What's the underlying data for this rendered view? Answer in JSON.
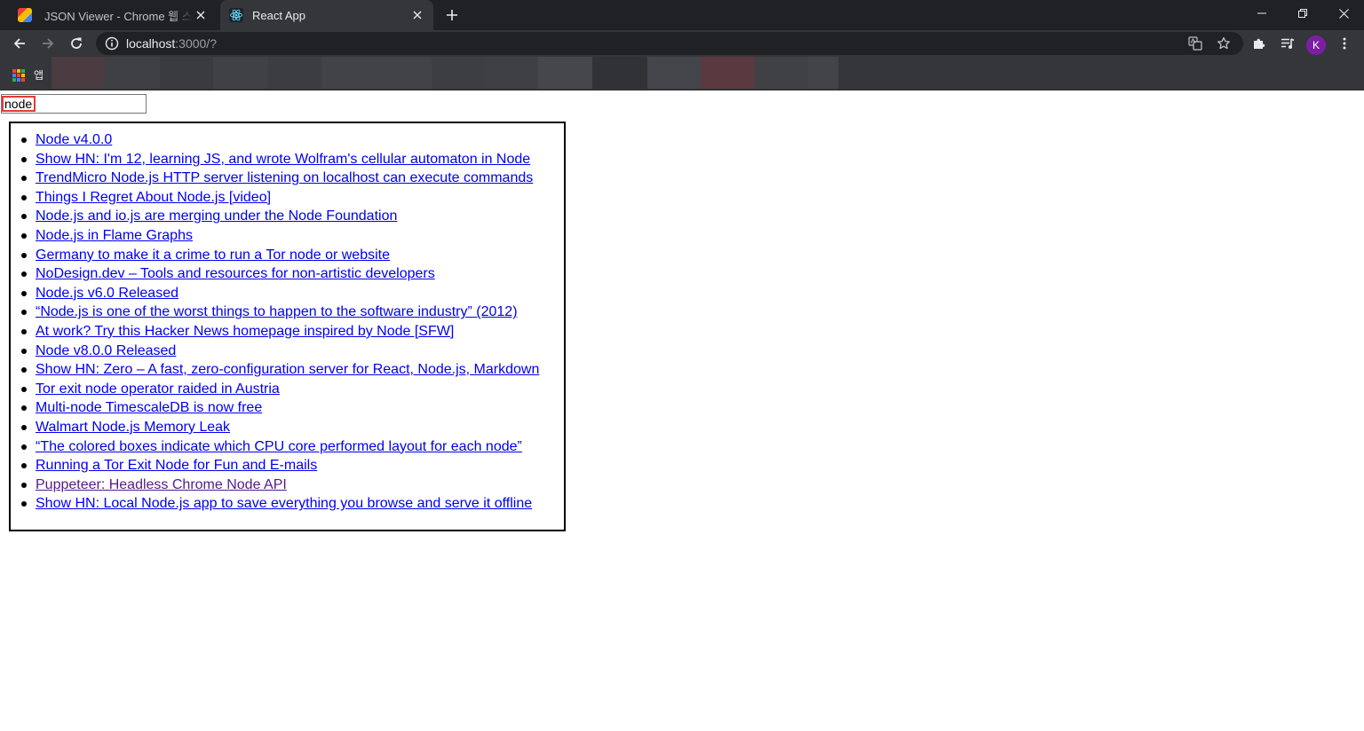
{
  "browser": {
    "tabs": [
      {
        "title": "JSON Viewer - Chrome 웹 스토어",
        "favicon": "json-viewer-icon",
        "active": false
      },
      {
        "title": "React App",
        "favicon": "react-icon",
        "active": true
      }
    ],
    "url_host": "localhost",
    "url_rest": ":3000/?",
    "profile_initial": "K",
    "bookmarks": {
      "apps_label": "앱"
    },
    "colors": {
      "frame": "#202124",
      "toolbar": "#35363a",
      "avatar": "#7b1fa2"
    }
  },
  "page": {
    "search": {
      "value": "node"
    },
    "results": [
      {
        "title": "Node v4.0.0",
        "visited": false
      },
      {
        "title": "Show HN: I'm 12, learning JS, and wrote Wolfram's cellular automaton in Node",
        "visited": false
      },
      {
        "title": "TrendMicro Node.js HTTP server listening on localhost can execute commands",
        "visited": false
      },
      {
        "title": "Things I Regret About Node.js [video]",
        "visited": false
      },
      {
        "title": "Node.js and io.js are merging under the Node Foundation",
        "visited": false
      },
      {
        "title": "Node.js in Flame Graphs",
        "visited": false
      },
      {
        "title": "Germany to make it a crime to run a Tor node or website",
        "visited": false
      },
      {
        "title": "NoDesign.dev – Tools and resources for non-artistic developers",
        "visited": false
      },
      {
        "title": "Node.js v6.0 Released",
        "visited": false
      },
      {
        "title": "“Node.js is one of the worst things to happen to the software industry” (2012)",
        "visited": false
      },
      {
        "title": "At work? Try this Hacker News homepage inspired by Node [SFW]",
        "visited": false
      },
      {
        "title": "Node v8.0.0 Released",
        "visited": false
      },
      {
        "title": "Show HN: Zero – A fast, zero-configuration server for React, Node.js, Markdown",
        "visited": false
      },
      {
        "title": "Tor exit node operator raided in Austria",
        "visited": false
      },
      {
        "title": "Multi-node TimescaleDB is now free",
        "visited": false
      },
      {
        "title": "Walmart Node.js Memory Leak",
        "visited": false
      },
      {
        "title": "“The colored boxes indicate which CPU core performed layout for each node”",
        "visited": false
      },
      {
        "title": "Running a Tor Exit Node for Fun and E-mails",
        "visited": false
      },
      {
        "title": "Puppeteer: Headless Chrome Node API",
        "visited": true
      },
      {
        "title": "Show HN: Local Node.js app to save everything you browse and serve it offline",
        "visited": false
      }
    ],
    "colors": {
      "link": "#0000ee",
      "visited_link": "#551a8b",
      "focus_ring": "#e53935"
    }
  }
}
